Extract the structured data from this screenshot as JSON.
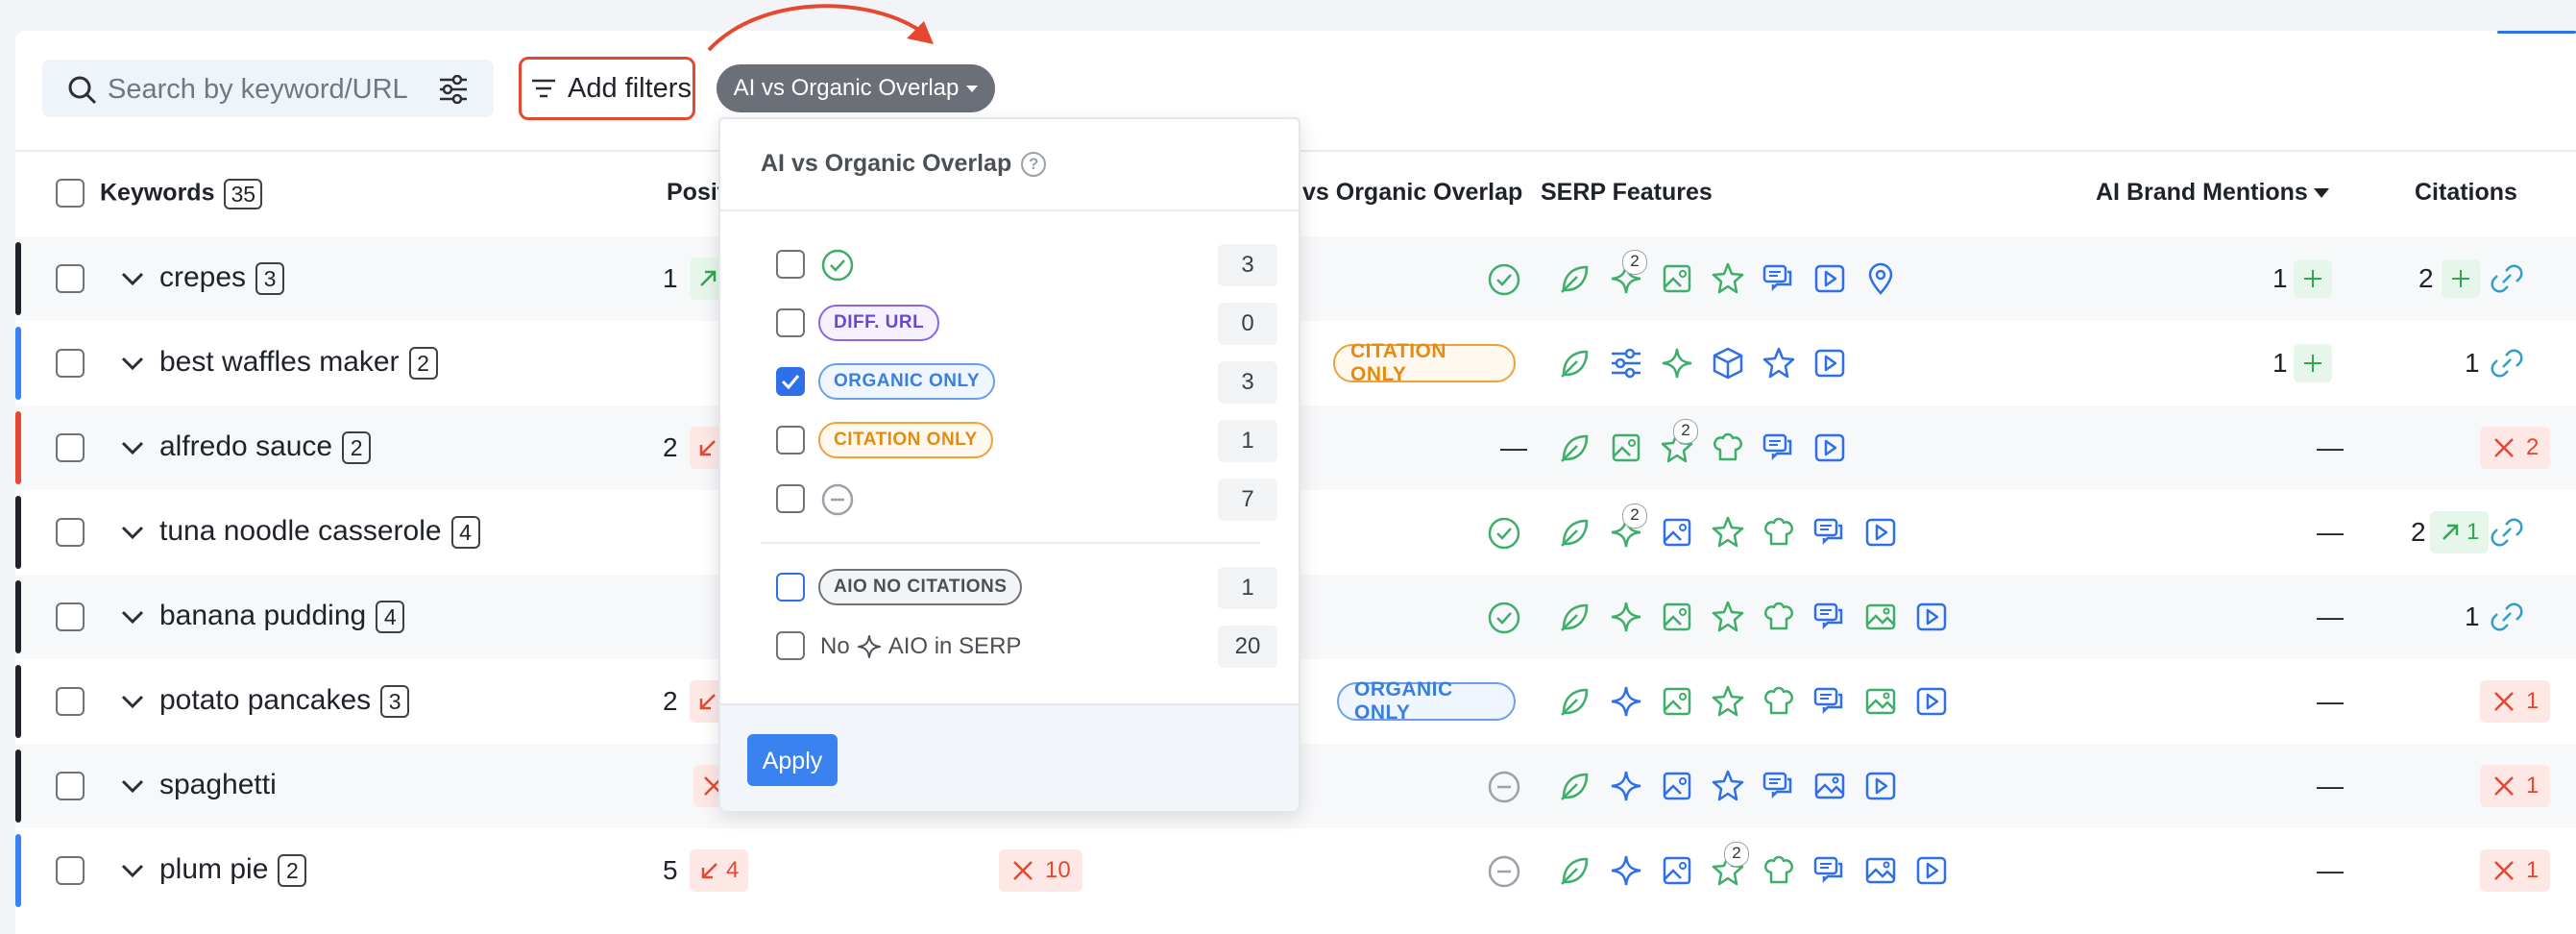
{
  "toolbar": {
    "search_placeholder": "Search by keyword/URL",
    "add_filters_label": "Add filters",
    "active_filter_label": "AI vs Organic Overlap"
  },
  "columns": {
    "keywords": "Keywords",
    "keywords_count": "35",
    "position": "Posit",
    "overlap": "vs Organic Overlap",
    "serp_features": "SERP Features",
    "ai_brand_mentions": "AI Brand Mentions",
    "citations": "Citations"
  },
  "rows": [
    {
      "keyword": "crepes",
      "count": "3",
      "position": "1",
      "mentions": "1",
      "citations": "2"
    },
    {
      "keyword": "best waffles maker",
      "count": "2",
      "overlap_badge": "CITATION ONLY",
      "mentions": "1",
      "citations": "1"
    },
    {
      "keyword": "alfredo sauce",
      "count": "2",
      "position": "2",
      "overlap_text": "—",
      "mentions": "—",
      "citations_x": "2"
    },
    {
      "keyword": "tuna noodle casserole",
      "count": "4",
      "mentions": "—",
      "citations": "2",
      "citations_delta": "1"
    },
    {
      "keyword": "banana pudding",
      "count": "4",
      "mentions": "—",
      "citations": "1"
    },
    {
      "keyword": "potato pancakes",
      "count": "3",
      "position": "2",
      "overlap_badge": "ORGANIC ONLY",
      "mentions": "—",
      "citations_x": "1"
    },
    {
      "keyword": "spaghetti",
      "mentions": "—",
      "citations_x": "1"
    },
    {
      "keyword": "plum pie",
      "count": "2",
      "position": "5",
      "position_delta": "4",
      "ai_x": "10",
      "mentions": "—",
      "citations_x": "1"
    }
  ],
  "serp_badges": {
    "crepes_sparkle": "2",
    "tuna_sparkle": "2",
    "alfredo_star": "2",
    "plum_star": "2"
  },
  "dropdown": {
    "title": "AI vs Organic Overlap",
    "options": [
      {
        "label": "",
        "count": "3"
      },
      {
        "label": "DIFF. URL",
        "count": "0"
      },
      {
        "label": "ORGANIC ONLY",
        "count": "3"
      },
      {
        "label": "CITATION ONLY",
        "count": "1"
      },
      {
        "label": "",
        "count": "7"
      },
      {
        "label": "AIO NO CITATIONS",
        "count": "1"
      },
      {
        "label_prefix": "No",
        "label_suffix": "AIO in SERP",
        "count": "20"
      }
    ],
    "apply_label": "Apply"
  },
  "colors": {
    "accent": "#2f6fe8",
    "highlight": "#e5482e",
    "green": "#2fa652",
    "orange": "#e58a12"
  }
}
